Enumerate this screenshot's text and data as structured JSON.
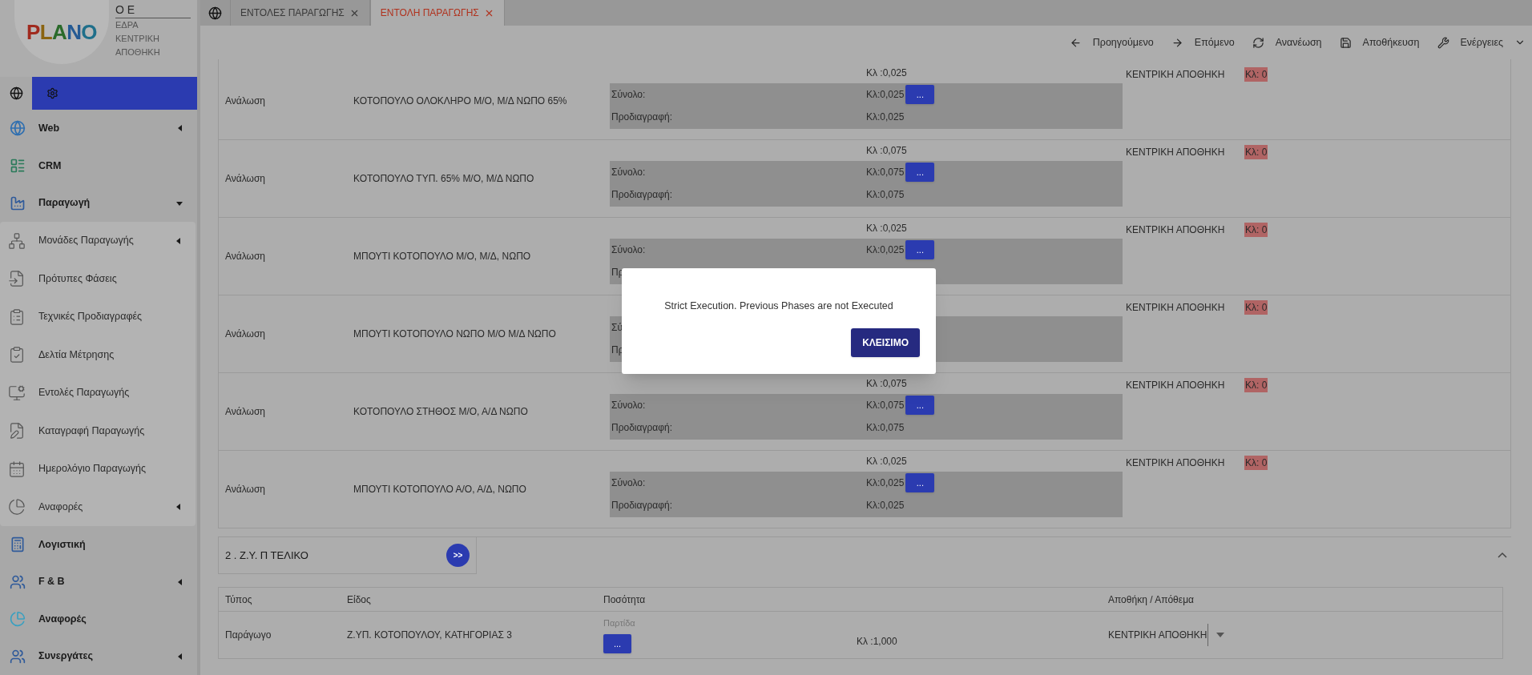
{
  "sidebar": {
    "logo": "PLANO",
    "company": {
      "name": "Ο Ε",
      "lines": [
        "ΕΔΡΑ",
        "ΚΕΝΤΡΙΚΗ",
        "ΑΠΟΘΗΚΗ"
      ]
    },
    "items": [
      {
        "label": "Web",
        "expanded": false
      },
      {
        "label": "CRM"
      },
      {
        "label": "Παραγωγή",
        "expanded": true,
        "children": [
          {
            "label": "Μονάδες Παραγωγής",
            "expanded": false
          },
          {
            "label": "Πρότυπες Φάσεις"
          },
          {
            "label": "Τεχνικές Προδιαγραφές"
          },
          {
            "label": "Δελτία Μέτρησης"
          },
          {
            "label": "Εντολές Παραγωγής"
          },
          {
            "label": "Καταγραφή Παραγωγής"
          },
          {
            "label": "Ημερολόγιο Παραγωγής"
          },
          {
            "label": "Αναφορές",
            "expanded": false
          }
        ]
      },
      {
        "label": "Λογιστική"
      },
      {
        "label": "F & B",
        "expanded": false
      },
      {
        "label": "Αναφορές"
      },
      {
        "label": "Συνεργάτες",
        "expanded": false
      }
    ]
  },
  "tabs": [
    {
      "label": "ΕΝΤΟΛΕΣ ΠΑΡΑΓΩΓΗΣ",
      "selected": false
    },
    {
      "label": "ΕΝΤΟΛΗ ΠΑΡΑΓΩΓΗΣ",
      "selected": true
    }
  ],
  "toolbar": [
    {
      "kind": "previous",
      "label": "Προηγούμενο"
    },
    {
      "kind": "next",
      "label": "Επόμενο"
    },
    {
      "kind": "refresh",
      "label": "Ανανέωση"
    },
    {
      "kind": "save",
      "label": "Αποθήκευση"
    },
    {
      "kind": "actions",
      "label": "Ενέργειες"
    }
  ],
  "rows": [
    {
      "type": "Ανάλωση",
      "item": "ΚΟΤΟΠΟΥΛΟ ΟΛΟΚΛΗΡΟ Μ/Ο, Μ/Δ ΝΩΠΟ 65%",
      "quantity": "Κλ :0,025",
      "total_label": "Σύνολο:",
      "total": "Κλ:0,025",
      "button": "...",
      "spec_label": "Προδιαγραφή:",
      "spec": "Κλ:0,025",
      "warehouse": "ΚΕΝΤΡΙΚΗ ΑΠΟΘΗΚΗ",
      "stock": "Κλ: 0"
    },
    {
      "type": "Ανάλωση",
      "item": "ΚΟΤΟΠΟΥΛΟ ΤΥΠ. 65% Μ/Ο, Μ/Δ ΝΩΠΟ",
      "quantity": "Κλ :0,075",
      "total_label": "Σύνολο:",
      "total": "Κλ:0,075",
      "button": "...",
      "spec_label": "Προδιαγραφή:",
      "spec": "Κλ:0,075",
      "warehouse": "ΚΕΝΤΡΙΚΗ ΑΠΟΘΗΚΗ",
      "stock": "Κλ: 0"
    },
    {
      "type": "Ανάλωση",
      "item": "ΜΠΟΥΤΙ ΚΟΤΟΠΟΥΛΟ Μ/Ο, Μ/Δ, ΝΩΠΟ",
      "quantity": "Κλ :0,025",
      "total_label": "Σύνολο:",
      "total": "Κλ:0,025",
      "button": "...",
      "spec_label": "Πρ",
      "warehouse": "ΚΕΝΤΡΙΚΗ ΑΠΟΘΗΚΗ",
      "stock": "Κλ: 0"
    },
    {
      "type": "Ανάλωση",
      "item": "ΜΠΟΥΤΙ ΚΟΤΟΠΟΥΛΟ ΝΩΠΟ Μ/Ο Μ/Δ ΝΩΠΟ",
      "total_label": "Σύ",
      "spec_label": "Πρ",
      "warehouse": "ΚΕΝΤΡΙΚΗ ΑΠΟΘΗΚΗ",
      "stock": "Κλ: 0"
    },
    {
      "type": "Ανάλωση",
      "item": "ΚΟΤΟΠΟΥΛΟ ΣΤΗΘΟΣ Μ/Ο, Α/Δ ΝΩΠΟ",
      "quantity": "Κλ :0,075",
      "total_label": "Σύνολο:",
      "total": "Κλ:0,075",
      "button": "...",
      "spec_label": "Προδιαγραφή:",
      "spec": "Κλ:0,075",
      "warehouse": "ΚΕΝΤΡΙΚΗ ΑΠΟΘΗΚΗ",
      "stock": "Κλ: 0"
    },
    {
      "type": "Ανάλωση",
      "item": "ΜΠΟΥΤΙ ΚΟΤΟΠΟΥΛΟ Α/Ο, Α/Δ, ΝΩΠΟ",
      "quantity": "Κλ :0,025",
      "total_label": "Σύνολο:",
      "total": "Κλ:0,025",
      "button": "...",
      "spec_label": "Προδιαγραφή:",
      "spec": "Κλ:0,025",
      "warehouse": "ΚΕΝΤΡΙΚΗ ΑΠΟΘΗΚΗ",
      "stock": "Κλ: 0"
    }
  ],
  "phase": {
    "title": "2 . Ζ.Υ. Π ΤΕΛΙΚΟ",
    "next_button": ">>",
    "expanded": true,
    "columns": [
      "Τύπος",
      "Είδος",
      "Ποσότητα",
      "Αποθήκη / Απόθεμα"
    ],
    "rows": [
      {
        "type": "Παράγωγο",
        "item": "Ζ.ΥΠ. ΚΟΤΟΠΟΥΛΟΥ, ΚΑΤΗΓΟΡΙΑΣ 3",
        "batch_placeholder": "Παρτίδα",
        "button": "...",
        "quantity": "Κλ :1,000",
        "warehouse": "ΚΕΝΤΡΙΚΗ ΑΠΟΘΗΚΗ"
      }
    ]
  },
  "dialog": {
    "message": "Strict Execution. Previous Phases are not Executed",
    "button": "ΚΛΕΙΣΙΜΟ"
  }
}
